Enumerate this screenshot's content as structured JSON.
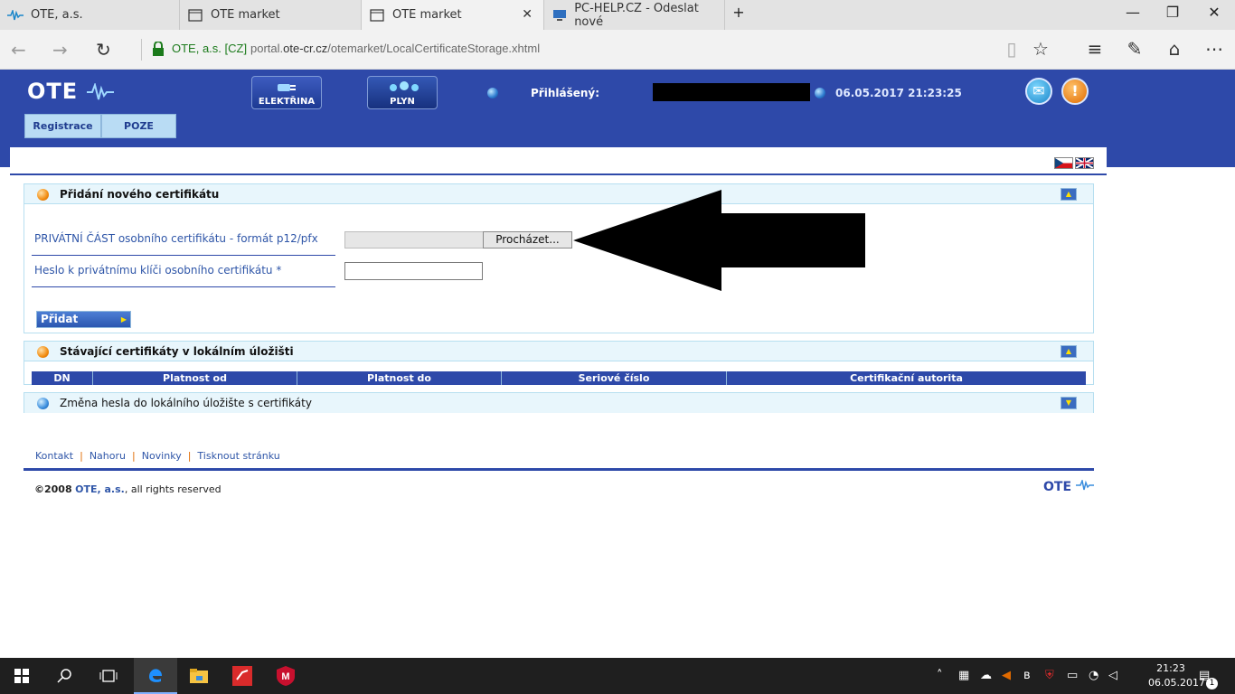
{
  "browser": {
    "tabs": [
      {
        "title": "OTE, a.s."
      },
      {
        "title": "OTE market"
      },
      {
        "title": "OTE market"
      },
      {
        "title": "PC-HELP.CZ - Odeslat nové"
      }
    ],
    "new_tab": "+",
    "secure_label": "OTE, a.s. [CZ]",
    "url_prefix": "portal.",
    "url_domain": "ote-cr.cz",
    "url_path": "/otemarket/LocalCertificateStorage.xhtml",
    "window_controls": {
      "minimize": "—",
      "restore": "❐",
      "close": "✕"
    }
  },
  "header": {
    "logo": "OTE",
    "section_buttons": [
      {
        "label": "ELEKTŘINA"
      },
      {
        "label": "PLYN"
      }
    ],
    "logged_in_label": "Přihlášený:",
    "datetime": "06.05.2017 21:23:25",
    "nav_tabs": [
      {
        "label": "Registrace"
      },
      {
        "label": "POZE"
      }
    ]
  },
  "add_cert": {
    "title": "Přidání nového certifikátu",
    "private_part_label": "PRIVÁTNÍ ČÁST osobního certifikátu - formát p12/pfx",
    "browse_label": "Procházet...",
    "password_label": "Heslo k privátnímu klíči osobního certifikátu *",
    "password_value": "",
    "add_button": "Přidat"
  },
  "existing_certs": {
    "title": "Stávající certifikáty v lokálním úložišti",
    "columns": [
      "DN",
      "Platnost od",
      "Platnost do",
      "Seriové číslo",
      "Certifikační autorita"
    ]
  },
  "change_password": {
    "title": "Změna hesla do lokálního úložište s certifikáty"
  },
  "footer": {
    "links": [
      "Kontakt",
      "Nahoru",
      "Novinky",
      "Tisknout stránku"
    ],
    "copyright_prefix": "©2008",
    "copyright_company": "OTE, a.s.",
    "copyright_suffix": ", all rights reserved",
    "logo": "OTE"
  },
  "taskbar": {
    "time": "21:23",
    "date": "06.05.2017",
    "notification_count": "1"
  },
  "colors": {
    "header_blue": "#2e49a9",
    "accent_orange": "#f28c10",
    "label_blue": "#2f56a8"
  }
}
